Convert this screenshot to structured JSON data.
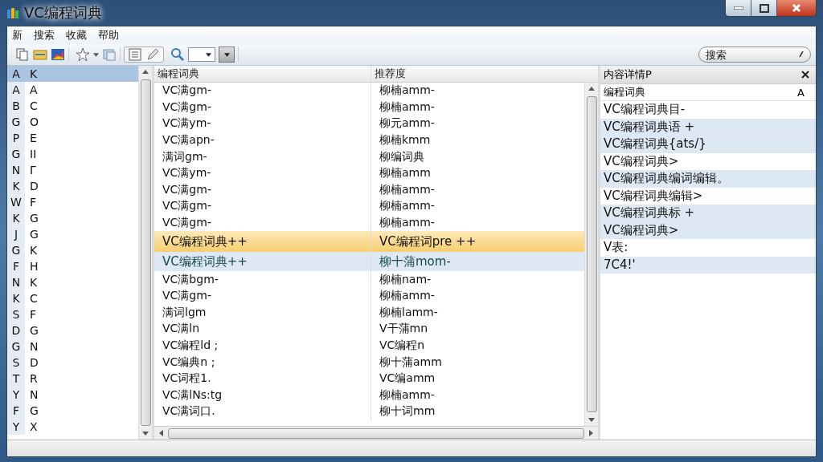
{
  "window": {
    "title": "VC编程词典"
  },
  "menu": [
    "新",
    "搜索",
    "收藏",
    "帮助"
  ],
  "toolbar": {
    "search": {
      "placeholder": "搜索"
    }
  },
  "index_list": {
    "header": [
      "A",
      "K"
    ],
    "rows": [
      [
        "A",
        "A"
      ],
      [
        "B",
        "C"
      ],
      [
        "G",
        "O"
      ],
      [
        "P",
        "E"
      ],
      [
        "G",
        "II"
      ],
      [
        "N",
        "Γ"
      ],
      [
        "K",
        "D"
      ],
      [
        "W",
        "F"
      ],
      [
        "K",
        "G"
      ],
      [
        "J",
        "G"
      ],
      [
        "G",
        "K"
      ],
      [
        "F",
        "H"
      ],
      [
        "N",
        "K"
      ],
      [
        "K",
        "C"
      ],
      [
        "S",
        "F"
      ],
      [
        "D",
        "G"
      ],
      [
        "G",
        "N"
      ],
      [
        "S",
        "D"
      ],
      [
        "T",
        "R"
      ],
      [
        "Y",
        "N"
      ],
      [
        "F",
        "G"
      ],
      [
        "Y",
        "X"
      ]
    ]
  },
  "table": {
    "columns": [
      "编程词典",
      "推荐度"
    ],
    "rows": [
      {
        "cells": [
          "VC满gm-",
          "柳楠amm-"
        ],
        "selected": false,
        "highlighted": false
      },
      {
        "cells": [
          "VC满gm-",
          "柳楠amm-"
        ],
        "selected": false,
        "highlighted": false
      },
      {
        "cells": [
          "VC满ym-",
          "柳元amm-"
        ],
        "selected": false,
        "highlighted": false
      },
      {
        "cells": [
          "VC满apn-",
          "柳楠kmm"
        ],
        "selected": false,
        "highlighted": false
      },
      {
        "cells": [
          "满词gm-",
          "柳编词典"
        ],
        "selected": false,
        "highlighted": false
      },
      {
        "cells": [
          "VC满ym-",
          "柳楠amm"
        ],
        "selected": false,
        "highlighted": false
      },
      {
        "cells": [
          "VC满gm-",
          "柳楠amm-"
        ],
        "selected": false,
        "highlighted": false
      },
      {
        "cells": [
          "VC满gm-",
          "柳楠amm-"
        ],
        "selected": false,
        "highlighted": false
      },
      {
        "cells": [
          "VC满gm-",
          "柳楠amm-"
        ],
        "selected": false,
        "highlighted": false
      },
      {
        "cells": [
          "VC编程词典++",
          "VC编程词pre ++"
        ],
        "selected": true,
        "highlighted": false
      },
      {
        "cells": [
          "VC编程词典++",
          "柳十蒲mom-"
        ],
        "selected": false,
        "highlighted": true
      },
      {
        "cells": [
          "VC满bgm-",
          "柳楠nam-"
        ],
        "selected": false,
        "highlighted": false
      },
      {
        "cells": [
          "VC满gm-",
          "柳楠amm-"
        ],
        "selected": false,
        "highlighted": false
      },
      {
        "cells": [
          "满词lgm",
          "柳楠lamm-"
        ],
        "selected": false,
        "highlighted": false
      },
      {
        "cells": [
          "VC满ln",
          "V干蒲mn"
        ],
        "selected": false,
        "highlighted": false
      },
      {
        "cells": [
          "VC编程ld ;",
          "VC编程n"
        ],
        "selected": false,
        "highlighted": false
      },
      {
        "cells": [
          "VC编典n ;",
          "柳十蒲amm"
        ],
        "selected": false,
        "highlighted": false
      },
      {
        "cells": [
          "VC词程1.",
          "VC编amm"
        ],
        "selected": false,
        "highlighted": false
      },
      {
        "cells": [
          "VC满lNs:tg",
          "柳楠amm-"
        ],
        "selected": false,
        "highlighted": false
      },
      {
        "cells": [
          "VC满词口.",
          "柳十词mm"
        ],
        "selected": false,
        "highlighted": false
      }
    ]
  },
  "detail_panel": {
    "title": "内容详情P",
    "header": "编程词典",
    "sort_label": "A",
    "items": [
      {
        "text": "VC编程词典目-",
        "shaded": false
      },
      {
        "text": "VC编程词典语 +",
        "shaded": true
      },
      {
        "text": "VC编程词典{ats/}",
        "shaded": true
      },
      {
        "text": "VC编程词典>",
        "shaded": false
      },
      {
        "text": "VC编程词典编词编辑。",
        "shaded": true
      },
      {
        "text": "VC编程词典编辑>",
        "shaded": false
      },
      {
        "text": "VC编程词典标 +",
        "shaded": true
      },
      {
        "text": "VC编程词典>",
        "shaded": true
      },
      {
        "text": "V表:",
        "shaded": false
      },
      {
        "text": "7C4!'",
        "shaded": true
      }
    ]
  }
}
